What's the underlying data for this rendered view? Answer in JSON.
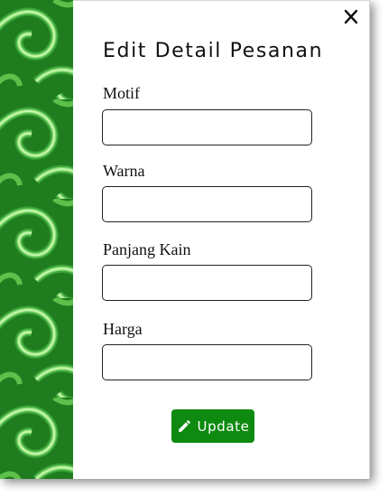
{
  "dialog": {
    "title": "Edit Detail Pesanan",
    "close_icon": "close-icon",
    "decor": "batik-megamendung-pattern"
  },
  "form": {
    "fields": [
      {
        "label": "Motif",
        "value": ""
      },
      {
        "label": "Warna",
        "value": ""
      },
      {
        "label": "Panjang Kain",
        "value": ""
      },
      {
        "label": "Harga",
        "value": ""
      }
    ],
    "submit": {
      "label": "Update",
      "icon": "pencil-icon",
      "color": "#0d8a0f"
    }
  },
  "colors": {
    "pattern_dark": "#1f7d1f",
    "pattern_light": "#a8f28a"
  }
}
